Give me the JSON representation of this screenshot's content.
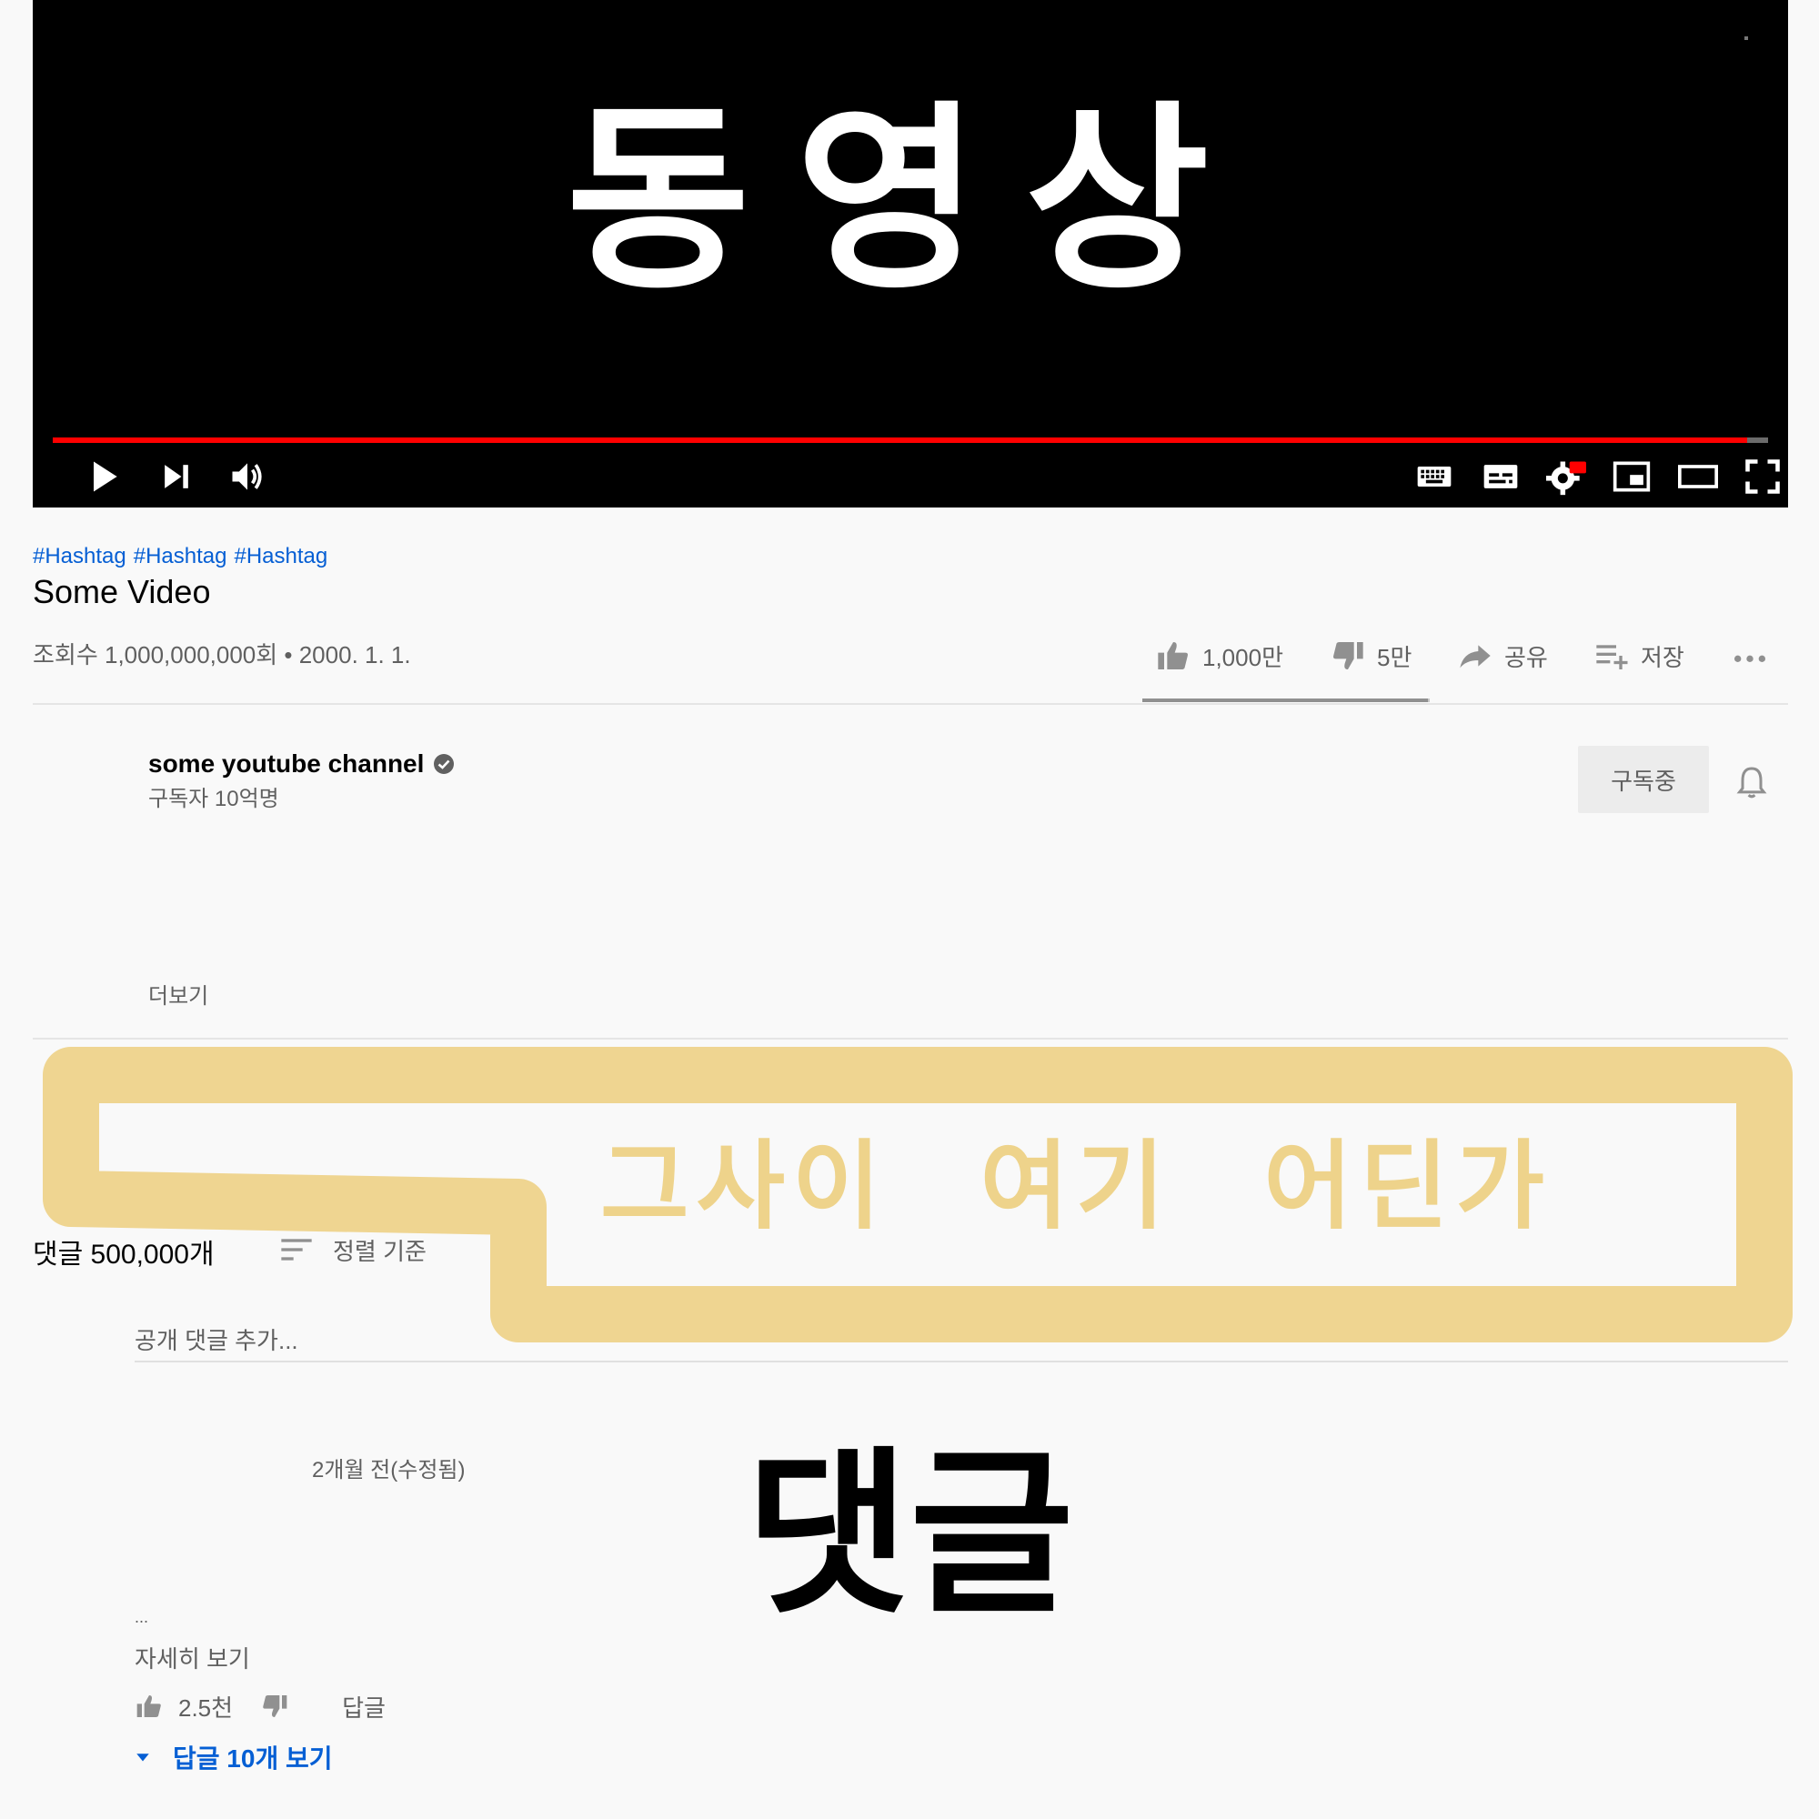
{
  "player": {
    "overlay_text": "동영상",
    "progress_fraction": 0.988,
    "controls_left": [
      "play-icon",
      "next-icon",
      "volume-icon"
    ],
    "controls_right": [
      "keyboard-icon",
      "subtitles-icon",
      "settings-icon",
      "miniplayer-icon",
      "theater-mode-icon",
      "fullscreen-icon"
    ],
    "settings_badge": "4K",
    "colors": {
      "progress": "#ff0000",
      "background": "#000000"
    }
  },
  "video": {
    "hashtags": [
      "#Hashtag",
      "#Hashtag",
      "#Hashtag"
    ],
    "title": "Some Video",
    "meta": "조회수 1,000,000,000회 • 2000. 1. 1.",
    "likes": "1,000만",
    "dislikes": "5만",
    "share_label": "공유",
    "save_label": "저장",
    "like_ratio": 0.995
  },
  "channel": {
    "name": "some youtube channel",
    "subscribers": "구독자 10억명",
    "subscribe_label": "구독중",
    "show_more": "더보기"
  },
  "annotation": {
    "text": "그사이 여기 어딘가",
    "color": "#eed38b"
  },
  "comments": {
    "count_label": "댓글 500,000개",
    "sort_label": "정렬 기준",
    "input_placeholder": "공개 댓글 추가...",
    "items": [
      {
        "time": "2개월 전(수정됨)",
        "text": "댓글",
        "ellipsis": "...",
        "read_more": "자세히 보기",
        "likes": "2.5천",
        "reply_label": "답글",
        "view_replies": "답글 10개 보기"
      }
    ]
  },
  "colors": {
    "link": "#065fd4",
    "secondary_text": "#606060",
    "page_bg": "#f9f9f9"
  }
}
